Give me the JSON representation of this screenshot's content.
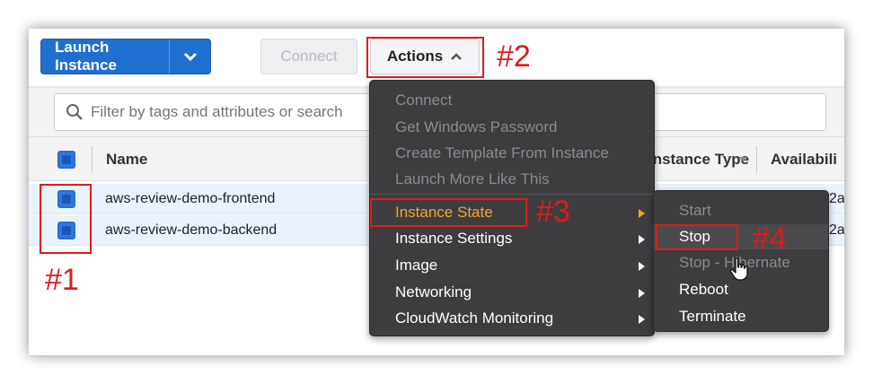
{
  "toolbar": {
    "launch_label": "Launch Instance",
    "connect_label": "Connect",
    "actions_label": "Actions"
  },
  "filter": {
    "placeholder": "Filter by tags and attributes or search"
  },
  "table": {
    "columns": [
      "Name",
      "Instance Type",
      "Availabili"
    ],
    "rows": [
      {
        "name": "aws-review-demo-frontend",
        "trail": "2a"
      },
      {
        "name": "aws-review-demo-backend",
        "trail": "2a"
      }
    ]
  },
  "actions_menu": {
    "items": [
      {
        "label": "Connect",
        "state": "disabled"
      },
      {
        "label": "Get Windows Password",
        "state": "disabled"
      },
      {
        "label": "Create Template From Instance",
        "state": "disabled"
      },
      {
        "label": "Launch More Like This",
        "state": "disabled"
      },
      {
        "label": "Instance State",
        "state": "active",
        "submenu": true
      },
      {
        "label": "Instance Settings",
        "state": "enabled",
        "submenu": true
      },
      {
        "label": "Image",
        "state": "enabled",
        "submenu": true
      },
      {
        "label": "Networking",
        "state": "enabled",
        "submenu": true
      },
      {
        "label": "CloudWatch Monitoring",
        "state": "enabled",
        "submenu": true
      }
    ]
  },
  "instance_state_menu": {
    "items": [
      {
        "label": "Start",
        "state": "disabled"
      },
      {
        "label": "Stop",
        "state": "hover"
      },
      {
        "label": "Stop - Hibernate",
        "state": "disabled"
      },
      {
        "label": "Reboot",
        "state": "enabled"
      },
      {
        "label": "Terminate",
        "state": "enabled"
      }
    ]
  },
  "annotations": {
    "step1": "#1",
    "step2": "#2",
    "step3": "#3",
    "step4": "#4"
  },
  "colors": {
    "primary": "#1f6fd0",
    "menu_bg": "#3d3d3f",
    "active_item": "#f0a32c",
    "annotation": "#e01b1b",
    "selected_row": "#eaf3fd"
  }
}
